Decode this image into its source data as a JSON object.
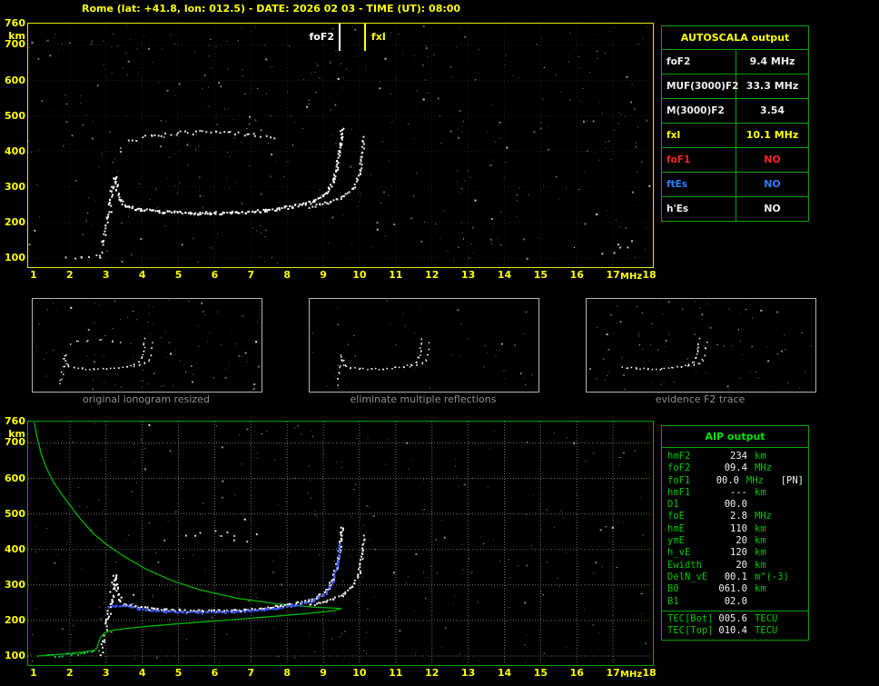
{
  "title": "Rome (lat: +41.8, lon: 012.5) - DATE: 2026 02 03 - TIME (UT): 08:00",
  "colors": {
    "white": "#f0f0f0",
    "yellow": "#ffff00",
    "red": "#ff2222",
    "blue": "#2f7bff",
    "green_border": "#00a400",
    "green_text": "#00c800",
    "green_bright": "#00e400",
    "profile_green": "#00b400",
    "fitted_blue": "#3c55ff",
    "caption_gray": "#8e8e8e"
  },
  "axes": {
    "y_ticks": [
      760,
      700,
      600,
      500,
      400,
      300,
      200,
      100
    ],
    "y_unit": "km",
    "x_ticks": [
      1,
      2,
      3,
      4,
      5,
      6,
      7,
      8,
      9,
      10,
      11,
      12,
      13,
      14,
      15,
      16,
      17,
      18
    ],
    "x_unit": "MHz",
    "f_min": 1,
    "f_max": 18,
    "km_min": 100,
    "km_max": 760
  },
  "top_plot": {
    "markers": [
      {
        "label": "foF2",
        "f": 9.4,
        "color": "#ffffff"
      },
      {
        "label": "fxI",
        "f": 10.1,
        "color": "#ffff00"
      }
    ]
  },
  "autoscala_table": {
    "header": "AUTOSCALA output",
    "rows": [
      {
        "label": "foF2",
        "value": "9.4 MHz",
        "color": "white"
      },
      {
        "label": "MUF(3000)F2",
        "value": "33.3 MHz",
        "color": "white"
      },
      {
        "label": "M(3000)F2",
        "value": "3.54",
        "color": "white"
      },
      {
        "label": "fxI",
        "value": "10.1 MHz",
        "color": "yellow"
      },
      {
        "label": "foF1",
        "value": "NO",
        "color": "red"
      },
      {
        "label": "ftEs",
        "value": "NO",
        "color": "blue"
      },
      {
        "label": "h'Es",
        "value": "NO",
        "color": "white"
      }
    ]
  },
  "thumbnails": [
    {
      "caption": "original ionogram resized"
    },
    {
      "caption": "eliminate multiple reflections"
    },
    {
      "caption": "evidence F2 trace"
    }
  ],
  "aip_table": {
    "header": "AIP output",
    "rows": [
      {
        "label": "hmF2",
        "value": "234",
        "unit": "km",
        "extra": ""
      },
      {
        "label": "foF2",
        "value": "09.4",
        "unit": "MHz",
        "extra": ""
      },
      {
        "label": "foF1",
        "value": "00.0",
        "unit": "MHz",
        "extra": "[PN]"
      },
      {
        "label": "hmF1",
        "value": "---",
        "unit": "km",
        "extra": ""
      },
      {
        "label": "D1",
        "value": "00.0",
        "unit": "",
        "extra": ""
      },
      {
        "label": "foE",
        "value": "2.8",
        "unit": "MHz",
        "extra": ""
      },
      {
        "label": "hmE",
        "value": "110",
        "unit": "km",
        "extra": ""
      },
      {
        "label": "ymE",
        "value": "20",
        "unit": "km",
        "extra": ""
      },
      {
        "label": "h_vE",
        "value": "120",
        "unit": "km",
        "extra": ""
      },
      {
        "label": "Ewidth",
        "value": "20",
        "unit": "km",
        "extra": ""
      },
      {
        "label": "DelN_vE",
        "value": "00.1",
        "unit": "m^(-3)",
        "extra": ""
      },
      {
        "label": "B0",
        "value": "061.0",
        "unit": "km",
        "extra": ""
      },
      {
        "label": "B1",
        "value": "02.0",
        "unit": "",
        "extra": ""
      }
    ],
    "tec_rows": [
      {
        "label": "TEC[Bot]",
        "value": "005.6",
        "unit": "TECU"
      },
      {
        "label": "TEC[Top]",
        "value": "010.4",
        "unit": "TECU"
      }
    ]
  },
  "trace_library": {
    "e_flat": {
      "color": "#cfcfcf",
      "step": 7,
      "size": 2,
      "jitter": 2,
      "points": [
        [
          1.9,
          101
        ],
        [
          2.3,
          104
        ],
        [
          2.7,
          107
        ]
      ]
    },
    "e_column": {
      "color": "#e8e8e8",
      "step": 4,
      "size": 2,
      "jitter": 2.5,
      "points": [
        [
          2.82,
          102
        ],
        [
          2.9,
          145
        ],
        [
          3.0,
          190
        ]
      ]
    },
    "cusp_rise": {
      "color": "#ffffff",
      "step": 2.5,
      "size": 2,
      "jitter": 2.5,
      "points": [
        [
          3.02,
          195
        ],
        [
          3.1,
          250
        ],
        [
          3.17,
          300
        ],
        [
          3.22,
          332
        ]
      ]
    },
    "cusp_fall": {
      "color": "#ffffff",
      "step": 2.5,
      "size": 2,
      "jitter": 2,
      "points": [
        [
          3.22,
          332
        ],
        [
          3.3,
          288
        ],
        [
          3.38,
          262
        ],
        [
          3.5,
          248
        ]
      ]
    },
    "f_flat": {
      "color": "#ffffff",
      "step": 1.8,
      "size": 2,
      "jitter": 1.6,
      "points": [
        [
          3.5,
          248
        ],
        [
          3.9,
          238
        ],
        [
          4.6,
          231
        ],
        [
          5.5,
          228
        ],
        [
          6.5,
          230
        ],
        [
          7.4,
          236
        ],
        [
          8.1,
          246
        ],
        [
          8.7,
          260
        ],
        [
          9.05,
          283
        ],
        [
          9.25,
          318
        ],
        [
          9.38,
          368
        ],
        [
          9.45,
          425
        ],
        [
          9.5,
          465
        ]
      ]
    },
    "f_x": {
      "color": "#e6e6e6",
      "step": 2.6,
      "size": 2,
      "jitter": 1.4,
      "points": [
        [
          8.6,
          246
        ],
        [
          9.1,
          258
        ],
        [
          9.5,
          274
        ],
        [
          9.8,
          298
        ],
        [
          9.97,
          338
        ],
        [
          10.05,
          390
        ],
        [
          10.1,
          440
        ]
      ]
    },
    "second_hop": {
      "color": "#dcdcdc",
      "step": 4.5,
      "size": 2,
      "jitter": 2,
      "points": [
        [
          3.6,
          430
        ],
        [
          4.2,
          446
        ],
        [
          5.0,
          455
        ],
        [
          6.0,
          456
        ],
        [
          6.9,
          450
        ],
        [
          7.6,
          442
        ]
      ]
    },
    "right_cluster": {
      "color": "#c8c8c8",
      "step": 5,
      "size": 2,
      "jitter": 7,
      "points": [
        [
          16.8,
          125
        ],
        [
          17.35,
          150
        ]
      ]
    },
    "spread_dots": {
      "color": "#cccccc",
      "step": 9,
      "size": 2,
      "jitter": 6,
      "points": [
        [
          5.2,
          428
        ],
        [
          6.2,
          444
        ],
        [
          7.1,
          432
        ]
      ]
    },
    "fitted_blue": {
      "color": "#3c55ff",
      "step": 3,
      "size": 2.4,
      "jitter": 1,
      "points": [
        [
          3.05,
          242
        ],
        [
          3.5,
          245
        ],
        [
          3.9,
          235
        ],
        [
          4.6,
          228
        ],
        [
          5.5,
          225
        ],
        [
          6.5,
          227
        ],
        [
          7.4,
          233
        ],
        [
          8.1,
          243
        ],
        [
          8.7,
          257
        ],
        [
          9.05,
          280
        ],
        [
          9.25,
          315
        ],
        [
          9.38,
          365
        ],
        [
          9.44,
          418
        ]
      ]
    },
    "e_green": {
      "color": "#00cc44",
      "step": 4,
      "size": 2,
      "jitter": 1.5,
      "points": [
        [
          1.35,
          102
        ],
        [
          1.9,
          106
        ],
        [
          2.4,
          110
        ],
        [
          2.75,
          116
        ]
      ]
    }
  },
  "profile_curve": [
    [
      1.02,
      758
    ],
    [
      1.1,
      715
    ],
    [
      1.2,
      672
    ],
    [
      1.35,
      630
    ],
    [
      1.55,
      590
    ],
    [
      1.78,
      555
    ],
    [
      2.0,
      525
    ],
    [
      2.3,
      485
    ],
    [
      2.65,
      445
    ],
    [
      3.0,
      415
    ],
    [
      3.5,
      380
    ],
    [
      4.1,
      345
    ],
    [
      4.8,
      313
    ],
    [
      5.6,
      286
    ],
    [
      6.6,
      263
    ],
    [
      7.7,
      247
    ],
    [
      8.7,
      238
    ],
    [
      9.35,
      234.5
    ],
    [
      9.5,
      234
    ],
    [
      9.3,
      228
    ],
    [
      8.7,
      221
    ],
    [
      7.8,
      213
    ],
    [
      6.8,
      205
    ],
    [
      5.8,
      197
    ],
    [
      4.9,
      190
    ],
    [
      4.2,
      184
    ],
    [
      3.6,
      178
    ],
    [
      3.15,
      172
    ],
    [
      2.98,
      166
    ],
    [
      2.88,
      157
    ],
    [
      2.82,
      146
    ],
    [
      2.78,
      134
    ],
    [
      2.75,
      122
    ],
    [
      2.68,
      116
    ],
    [
      2.4,
      111
    ],
    [
      2.0,
      107
    ],
    [
      1.5,
      103
    ],
    [
      1.1,
      100
    ]
  ]
}
